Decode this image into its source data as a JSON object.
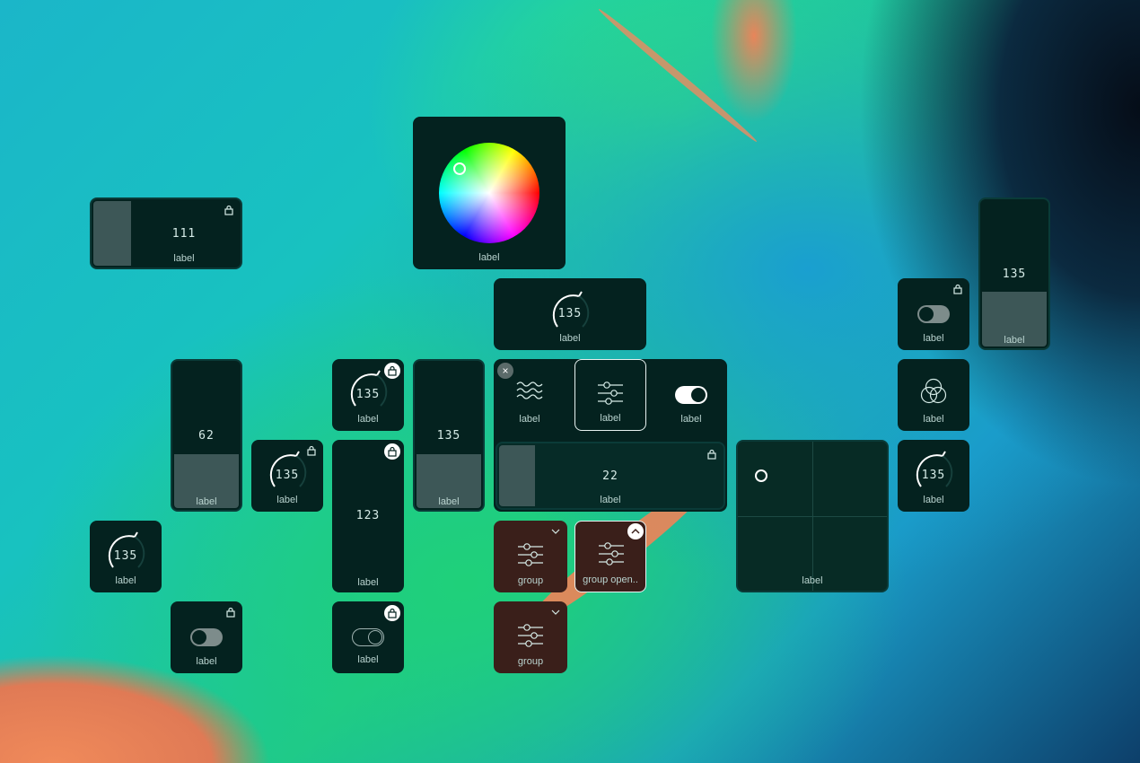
{
  "widgets": {
    "slider_h_111": {
      "value": "111",
      "label": "label",
      "fill_fraction": 0.26
    },
    "color_wheel": {
      "label": "label"
    },
    "knob_top": {
      "value": "135",
      "label": "label"
    },
    "slider_v_62": {
      "value": "62",
      "label": "label",
      "fill_fraction": 0.38
    },
    "knob_a": {
      "value": "135",
      "label": "label"
    },
    "knob_b": {
      "value": "135",
      "label": "label"
    },
    "knob_c": {
      "value": "135",
      "label": "label"
    },
    "knob_d": {
      "value": "135",
      "label": "label"
    },
    "slider_v_123": {
      "value": "123",
      "label": "label"
    },
    "slider_v_135": {
      "value": "135",
      "label": "label",
      "fill_fraction": 0.38
    },
    "panel": {
      "close_glyph": "×",
      "items": [
        {
          "label": "label",
          "icon": "waves-icon"
        },
        {
          "label": "label",
          "icon": "sliders-icon"
        },
        {
          "label": "label",
          "icon": "toggle-icon"
        }
      ],
      "slider": {
        "value": "22",
        "label": "label",
        "fill_fraction": 0.17
      }
    },
    "xy_pad": {
      "label": "label"
    },
    "toggle_a": {
      "label": "label"
    },
    "toggle_b": {
      "label": "label"
    },
    "toggle_c": {
      "label": "label"
    },
    "blend": {
      "label": "label",
      "icon": "color-blend-icon"
    },
    "slider_v_right": {
      "value": "135",
      "label": "label",
      "fill_fraction": 0.37
    },
    "group_a": {
      "label": "group"
    },
    "group_open": {
      "label": "group open.."
    },
    "group_b": {
      "label": "group"
    }
  },
  "colors": {
    "widget_bg": "#04221f",
    "fill": "#3d5757",
    "group_bg": "#3a1f1a"
  }
}
